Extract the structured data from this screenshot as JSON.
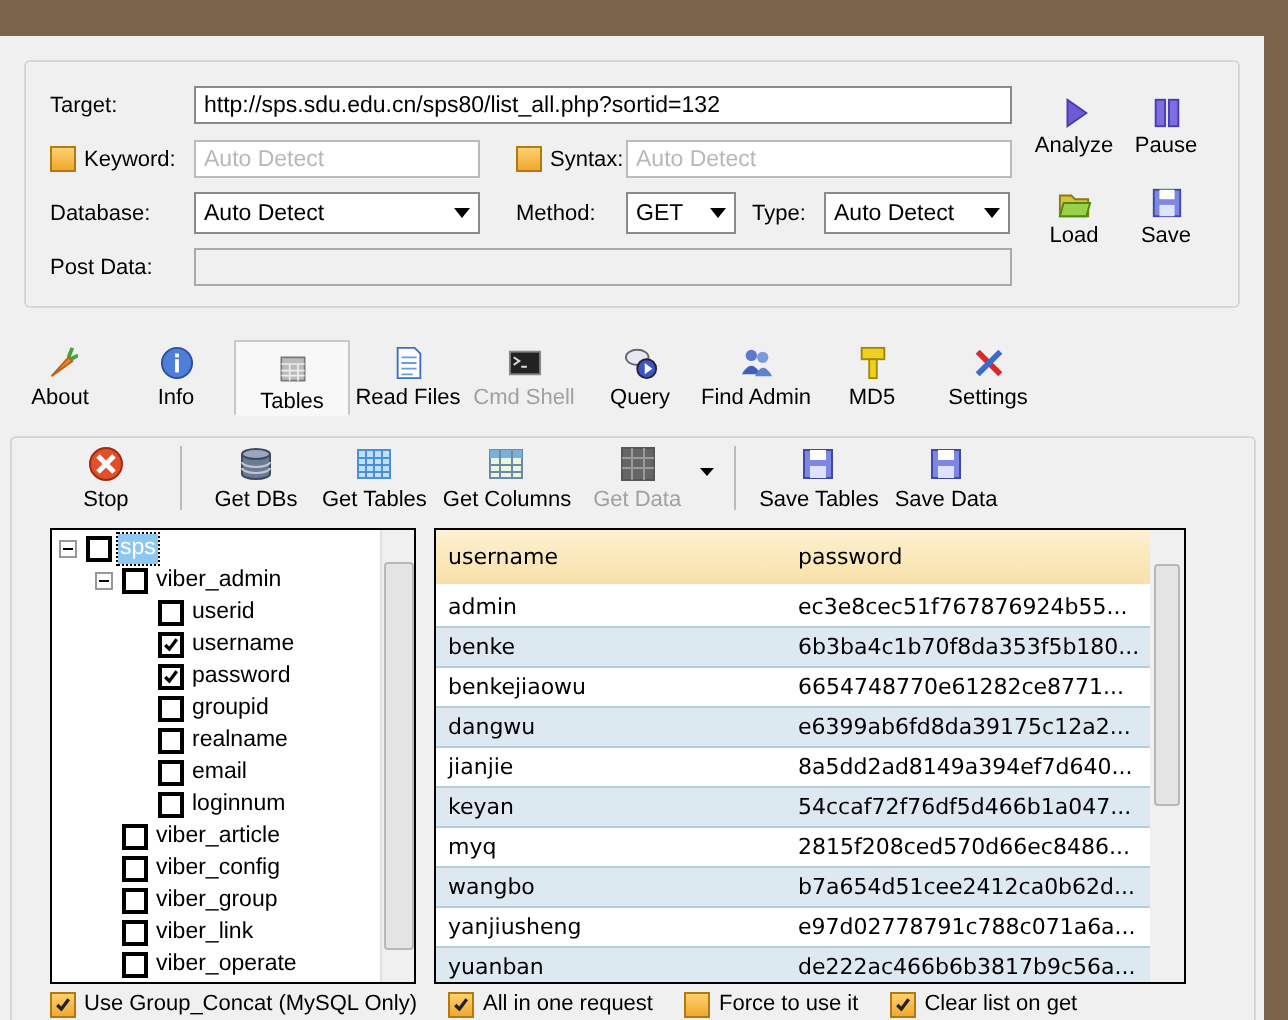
{
  "form": {
    "target": {
      "label": "Target:",
      "value": "http://sps.sdu.edu.cn/sps80/list_all.php?sortid=132"
    },
    "keyword": {
      "label": "Keyword:",
      "checked": false,
      "placeholder": "Auto Detect"
    },
    "syntax": {
      "label": "Syntax:",
      "checked": false,
      "placeholder": "Auto Detect"
    },
    "database": {
      "label": "Database:",
      "value": "Auto Detect"
    },
    "method": {
      "label": "Method:",
      "value": "GET"
    },
    "type": {
      "label": "Type:",
      "value": "Auto Detect"
    },
    "post_data": {
      "label": "Post Data:"
    }
  },
  "actions": [
    {
      "label": "Analyze"
    },
    {
      "label": "Pause"
    },
    {
      "label": "Load"
    },
    {
      "label": "Save"
    }
  ],
  "tabs": [
    {
      "label": "About",
      "selected": false,
      "disabled": false
    },
    {
      "label": "Info",
      "selected": false,
      "disabled": false
    },
    {
      "label": "Tables",
      "selected": true,
      "disabled": false
    },
    {
      "label": "Read Files",
      "selected": false,
      "disabled": false
    },
    {
      "label": "Cmd Shell",
      "selected": false,
      "disabled": true
    },
    {
      "label": "Query",
      "selected": false,
      "disabled": false
    },
    {
      "label": "Find Admin",
      "selected": false,
      "disabled": false
    },
    {
      "label": "MD5",
      "selected": false,
      "disabled": false
    },
    {
      "label": "Settings",
      "selected": false,
      "disabled": false
    }
  ],
  "toolbar": [
    [
      {
        "label": "Stop",
        "disabled": false,
        "dropdown": false
      }
    ],
    [
      {
        "label": "Get DBs",
        "disabled": false,
        "dropdown": false
      },
      {
        "label": "Get Tables",
        "disabled": false,
        "dropdown": false
      },
      {
        "label": "Get Columns",
        "disabled": false,
        "dropdown": false
      },
      {
        "label": "Get Data",
        "disabled": true,
        "dropdown": true
      }
    ],
    [
      {
        "label": "Save Tables",
        "disabled": false,
        "dropdown": false
      },
      {
        "label": "Save Data",
        "disabled": false,
        "dropdown": false
      }
    ]
  ],
  "tree": {
    "items": [
      {
        "label": "sps",
        "checked": false,
        "selected": true,
        "expanded": true,
        "children": [
          {
            "label": "viber_admin",
            "checked": false,
            "selected": false,
            "expanded": true,
            "children": [
              {
                "label": "userid",
                "checked": false,
                "selected": false
              },
              {
                "label": "username",
                "checked": true,
                "selected": false
              },
              {
                "label": "password",
                "checked": true,
                "selected": false
              },
              {
                "label": "groupid",
                "checked": false,
                "selected": false
              },
              {
                "label": "realname",
                "checked": false,
                "selected": false
              },
              {
                "label": "email",
                "checked": false,
                "selected": false
              },
              {
                "label": "loginnum",
                "checked": false,
                "selected": false
              }
            ]
          },
          {
            "label": "viber_article",
            "checked": false,
            "selected": false
          },
          {
            "label": "viber_config",
            "checked": false,
            "selected": false
          },
          {
            "label": "viber_group",
            "checked": false,
            "selected": false
          },
          {
            "label": "viber_link",
            "checked": false,
            "selected": false
          },
          {
            "label": "viber_operate",
            "checked": false,
            "selected": false
          }
        ]
      }
    ]
  },
  "grid": {
    "columns": [
      "username",
      "password"
    ],
    "rows": [
      [
        "admin",
        "ec3e8cec51f767876924b55..."
      ],
      [
        "benke",
        "6b3ba4c1b70f8da353f5b180..."
      ],
      [
        "benkejiaowu",
        "6654748770e61282ce8771..."
      ],
      [
        "dangwu",
        "e6399ab6fd8da39175c12a2..."
      ],
      [
        "jianjie",
        "8a5dd2ad8149a394ef7d640..."
      ],
      [
        "keyan",
        "54ccaf72f76df5d466b1a047..."
      ],
      [
        "myq",
        "2815f208ced570d66ec8486..."
      ],
      [
        "wangbo",
        "b7a654d51cee2412ca0b62d..."
      ],
      [
        "yanjiusheng",
        "e97d02778791c788c071a6a..."
      ],
      [
        "yuanban",
        "de222ac466b6b3817b9c56a..."
      ]
    ]
  },
  "options": [
    {
      "label": "Use Group_Concat (MySQL Only)",
      "checked": true
    },
    {
      "label": "All in one request",
      "checked": true
    },
    {
      "label": "Force to use it",
      "checked": false
    },
    {
      "label": "Clear list on get",
      "checked": true
    }
  ]
}
